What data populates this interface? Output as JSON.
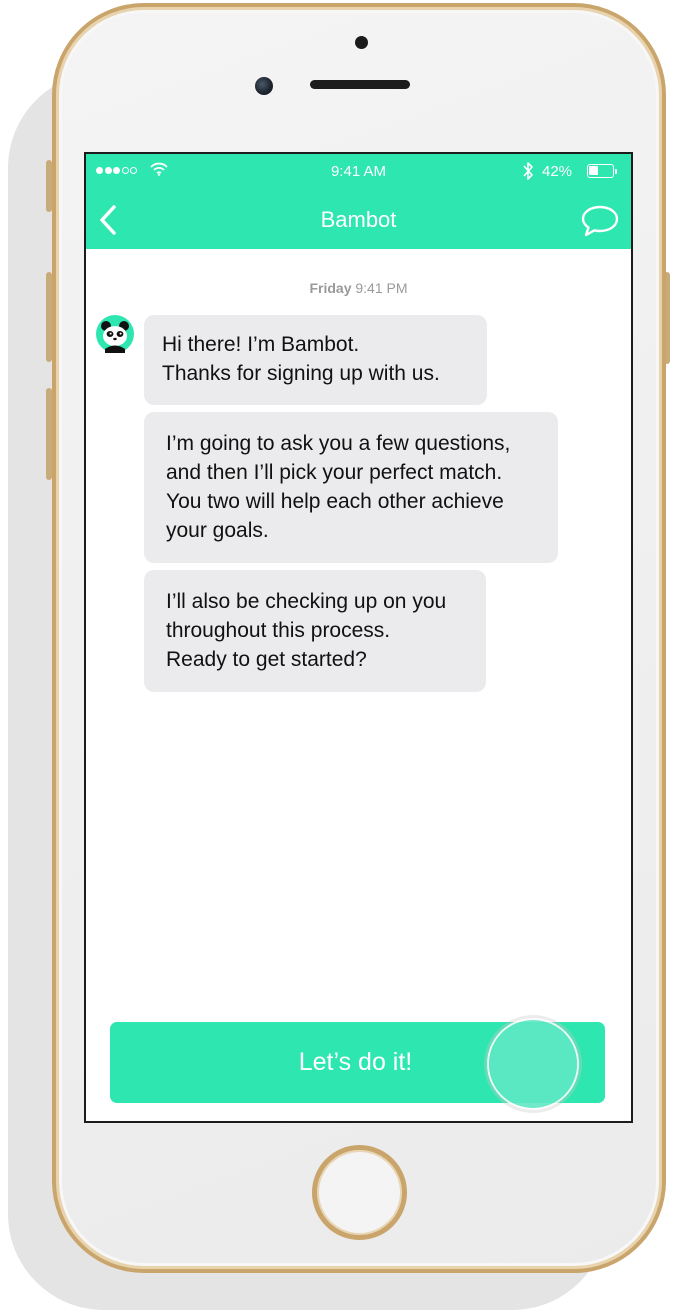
{
  "colors": {
    "accent": "#2ee6b0",
    "bubble": "#ebebed",
    "frame_gold": "#c9a46b",
    "timestamp": "#9a9a9a"
  },
  "status_bar": {
    "time": "9:41 AM",
    "battery_percent": "42%",
    "battery_level": 0.42,
    "signal_bars_filled": 3,
    "signal_bars_total": 5,
    "icons": [
      "signal-dots-icon",
      "wifi-icon",
      "bluetooth-icon",
      "battery-icon"
    ]
  },
  "nav": {
    "title": "Bambot",
    "back_icon": "chevron-left-icon",
    "chat_icon": "speech-bubble-icon"
  },
  "conversation": {
    "timestamp_day": "Friday",
    "timestamp_time": "9:41 PM",
    "avatar_icon": "panda-icon",
    "messages": [
      {
        "lines": [
          "Hi there! I’m Bambot.",
          "Thanks for signing up with us."
        ]
      },
      {
        "lines": [
          "I’m going to ask you a few questions,",
          "and then I’ll pick your perfect match.",
          "You two will help each other achieve",
          "your goals."
        ]
      },
      {
        "lines": [
          "I’ll also be checking up on you",
          "throughout this process.",
          "Ready to get started?"
        ]
      }
    ]
  },
  "cta": {
    "label": "Let’s do it!"
  }
}
